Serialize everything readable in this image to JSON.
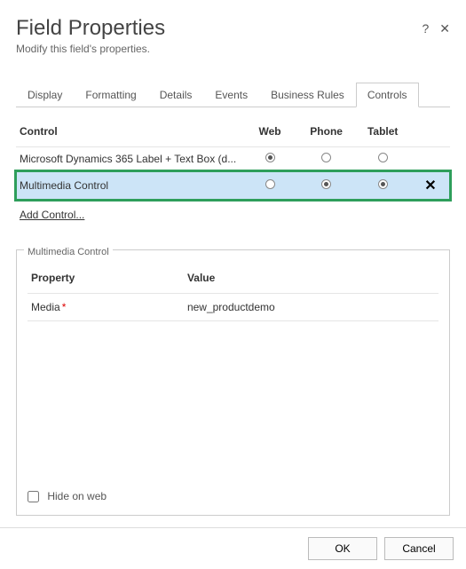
{
  "header": {
    "title": "Field Properties",
    "subtitle": "Modify this field's properties."
  },
  "tabs": {
    "items": [
      {
        "label": "Display"
      },
      {
        "label": "Formatting"
      },
      {
        "label": "Details"
      },
      {
        "label": "Events"
      },
      {
        "label": "Business Rules"
      },
      {
        "label": "Controls"
      }
    ]
  },
  "controls": {
    "columns": {
      "control": "Control",
      "web": "Web",
      "phone": "Phone",
      "tablet": "Tablet"
    },
    "rows": [
      {
        "name": "Microsoft Dynamics 365 Label + Text Box (d...",
        "web": true,
        "phone": false,
        "tablet": false,
        "selected": false,
        "removable": false
      },
      {
        "name": "Multimedia Control",
        "web": false,
        "phone": true,
        "tablet": true,
        "selected": true,
        "removable": true
      }
    ],
    "addLink": "Add Control..."
  },
  "detail": {
    "legend": "Multimedia Control",
    "columns": {
      "property": "Property",
      "value": "Value"
    },
    "properties": [
      {
        "name": "Media",
        "required": true,
        "value": "new_productdemo"
      }
    ],
    "hideOnWebLabel": "Hide on web",
    "hideOnWebChecked": false
  },
  "footer": {
    "ok": "OK",
    "cancel": "Cancel"
  }
}
